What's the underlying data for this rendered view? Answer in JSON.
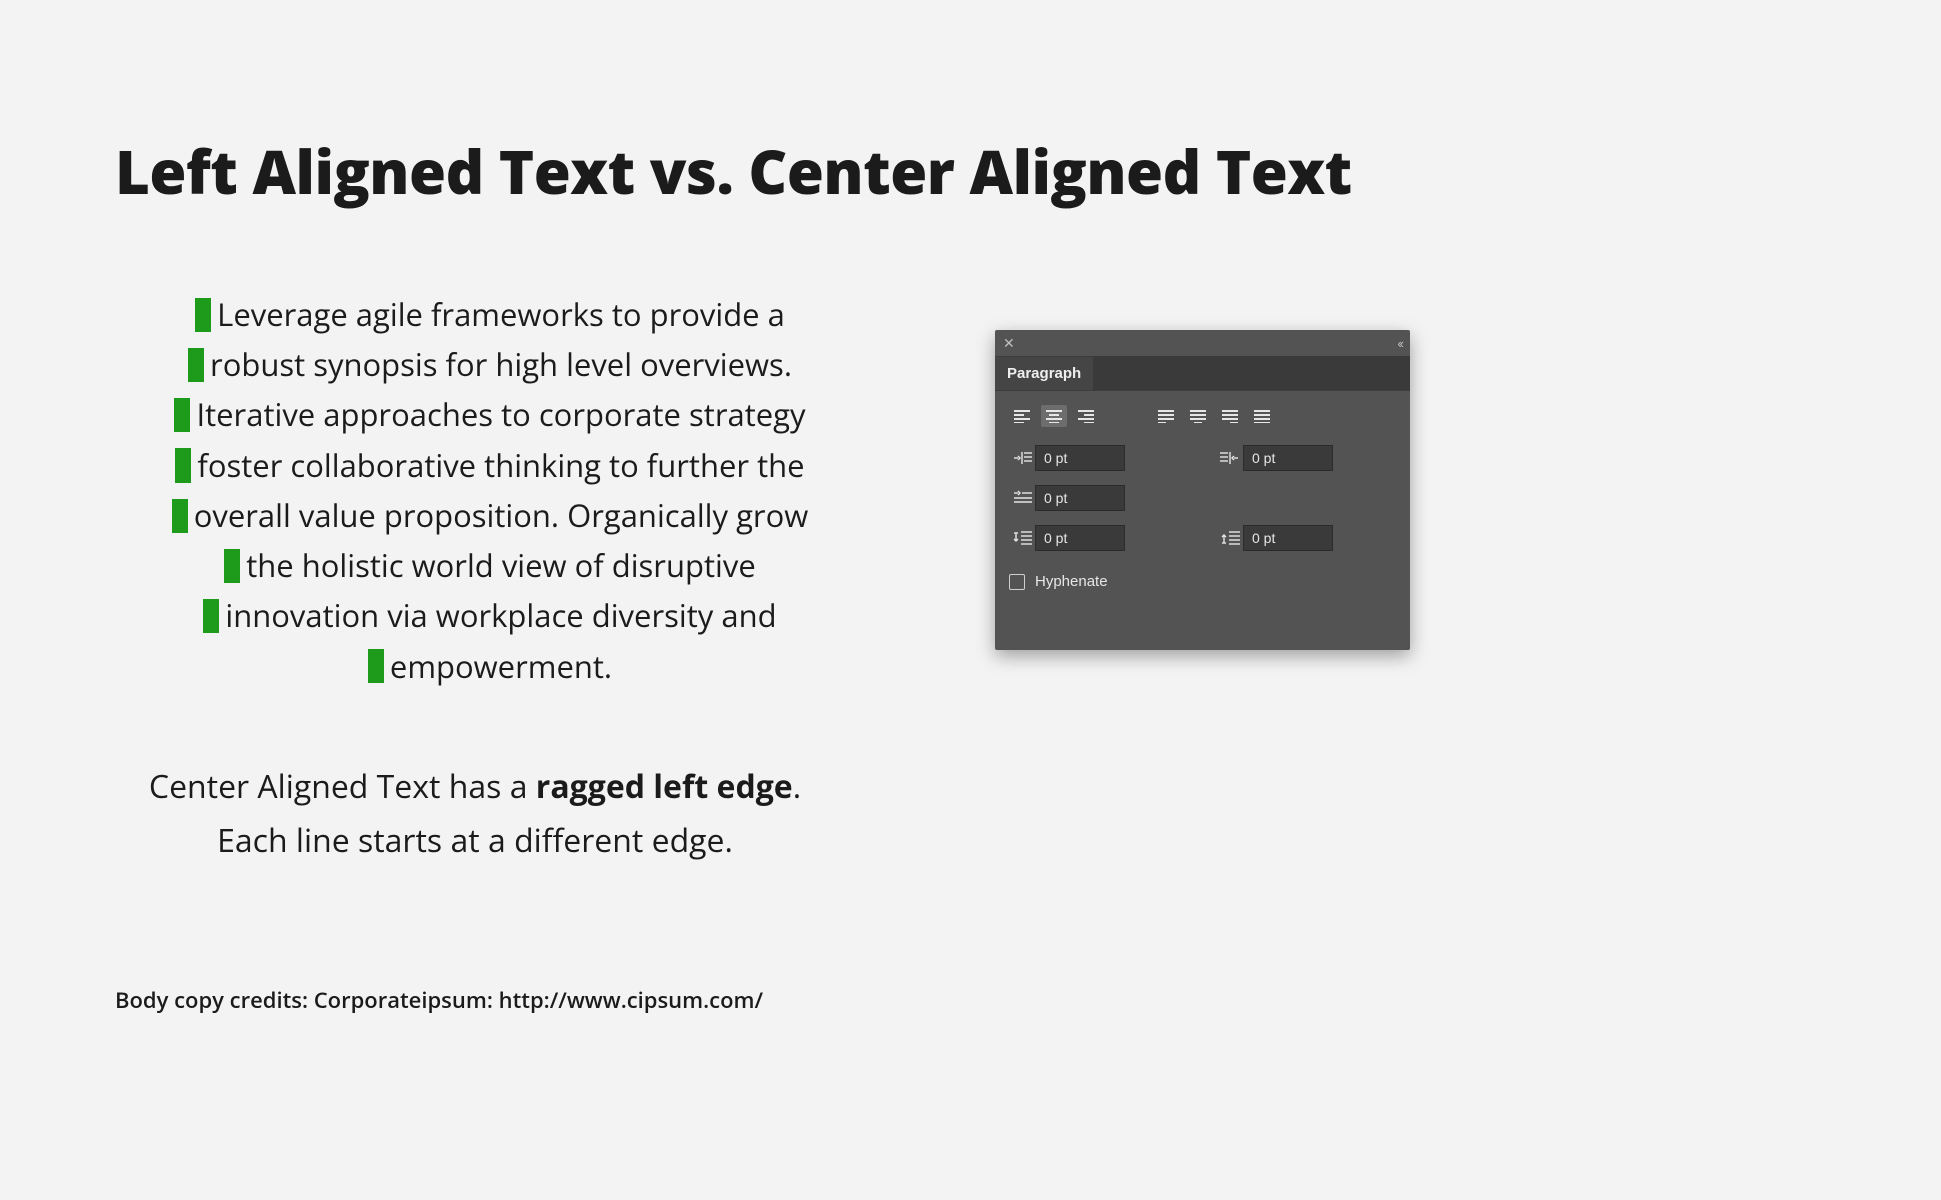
{
  "title": "Left Aligned Text vs. Center Aligned Text",
  "sample_lines": [
    "Leverage agile frameworks to provide a",
    "robust synopsis for high level overviews.",
    "Iterative approaches to corporate strategy",
    "foster collaborative thinking to further the",
    "overall value proposition. Organically grow",
    "the holistic world view of disruptive",
    "innovation via workplace diversity and",
    "empowerment."
  ],
  "caption_pre": "Center Aligned Text has a ",
  "caption_bold": "ragged left edge",
  "caption_post": ".",
  "caption_line2": "Each line starts at a different edge.",
  "credits": "Body copy credits: Corporateipsum: http://www.cipsum.com/",
  "panel": {
    "tab_label": "Paragraph",
    "left_indent": "0 pt",
    "right_indent": "0 pt",
    "first_line": "0 pt",
    "space_before": "0 pt",
    "space_after": "0 pt",
    "hyphenate_label": "Hyphenate",
    "selected_align": "center"
  }
}
